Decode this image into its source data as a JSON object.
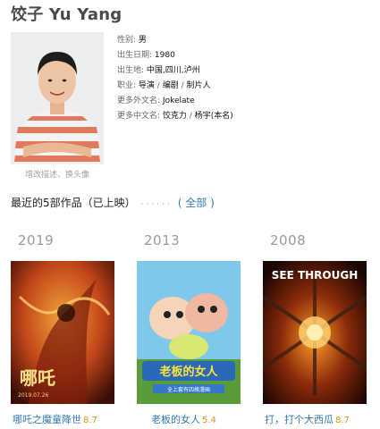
{
  "header": {
    "title": "饺子 Yu Yang"
  },
  "profile": {
    "edit_link": "增改描述、换头像",
    "gender_label": "性别:",
    "gender": "男",
    "birthdate_label": "出生日期:",
    "birthdate": "1980",
    "birthplace_label": "出生地:",
    "birthplace": "中国,四川,泸州",
    "occupation_label": "职业:",
    "occupations": [
      "导演",
      "编剧",
      "制片人"
    ],
    "occ_sep": " / ",
    "foreign_names_label": "更多外文名:",
    "foreign_names": "Jokelate",
    "chinese_names_label": "更多中文名:",
    "chinese_names": [
      "饺克力",
      "杨宇(本名)"
    ]
  },
  "recent_works": {
    "heading": "最近的5部作品（已上映）",
    "dots": "······",
    "all_link": "( 全部 )",
    "items": [
      {
        "year": "2019",
        "title": "哪吒之魔童降世",
        "rating": "8.7"
      },
      {
        "year": "2013",
        "title": "老板的女人",
        "rating": "5.4"
      },
      {
        "year": "2008",
        "title": "打，打个大西瓜",
        "rating": "8.7"
      }
    ]
  },
  "poster_text": {
    "p1_title": "哪吒",
    "p1_date": "2019.07.26",
    "p2_title": "老板的女人",
    "p2_sub": "全上套有四格漫画",
    "p3_title": "SEE THROUGH"
  }
}
